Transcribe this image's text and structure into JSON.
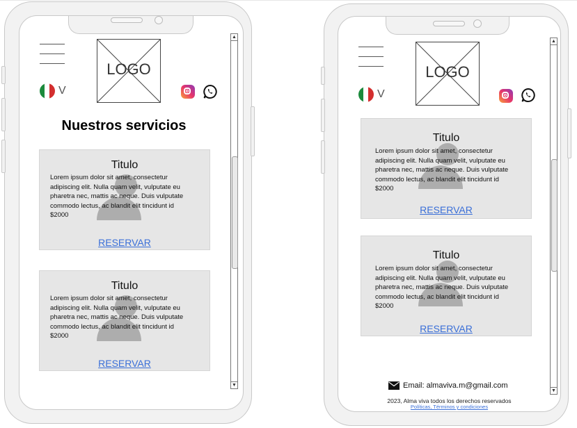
{
  "brand": {
    "logo_text": "LOGO"
  },
  "language": {
    "flag": "mexico-flag-icon",
    "chevron": "V"
  },
  "social": {
    "instagram": "instagram-icon",
    "whatsapp": "whatsapp-icon"
  },
  "colors": {
    "card_bg": "#e6e6e6",
    "link": "#3a6fd8",
    "ghost": "#a6a6a6"
  },
  "left_screen": {
    "section_title": "Nuestros servicios",
    "cards": [
      {
        "title": "Titulo",
        "body": [
          "Lorem ipsum dolor sit amet, consectetur",
          "adipiscing elit. Nulla quam velit, vulputate eu",
          "pharetra nec, mattis ac neque. Duis vulputate",
          "commodo lectus, ac blandit elit tincidunt id",
          "$2000"
        ],
        "cta": "RESERVAR"
      },
      {
        "title": "Titulo",
        "body": [
          "Lorem ipsum dolor sit amet, consectetur",
          "adipiscing elit. Nulla quam velit, vulputate eu",
          "pharetra nec, mattis ac neque. Duis vulputate",
          "commodo lectus, ac blandit elit tincidunt id",
          "$2000"
        ],
        "cta": "RESERVAR"
      }
    ]
  },
  "right_screen": {
    "cards": [
      {
        "title": "Titulo",
        "body": [
          "Lorem ipsum dolor sit amet, consectetur",
          "adipiscing elit. Nulla quam velit, vulputate eu",
          "pharetra nec, mattis ac neque. Duis vulputate",
          "commodo lectus, ac blandit elit tincidunt id",
          "$2000"
        ],
        "cta": "RESERVAR"
      },
      {
        "title": "Titulo",
        "body": [
          "Lorem ipsum dolor sit amet, consectetur",
          "adipiscing elit. Nulla quam velit, vulputate eu",
          "pharetra nec, mattis ac neque. Duis vulputate",
          "commodo lectus, ac blandit elit tincidunt id",
          "$2000"
        ],
        "cta": "RESERVAR"
      }
    ],
    "footer": {
      "email": "Email: almaviva.m@gmail.com",
      "email_icon": "envelope-icon",
      "copyright": "2023, Alma viva todos los derechos reservados",
      "links": "Políticas, Términos y condiciones"
    }
  }
}
